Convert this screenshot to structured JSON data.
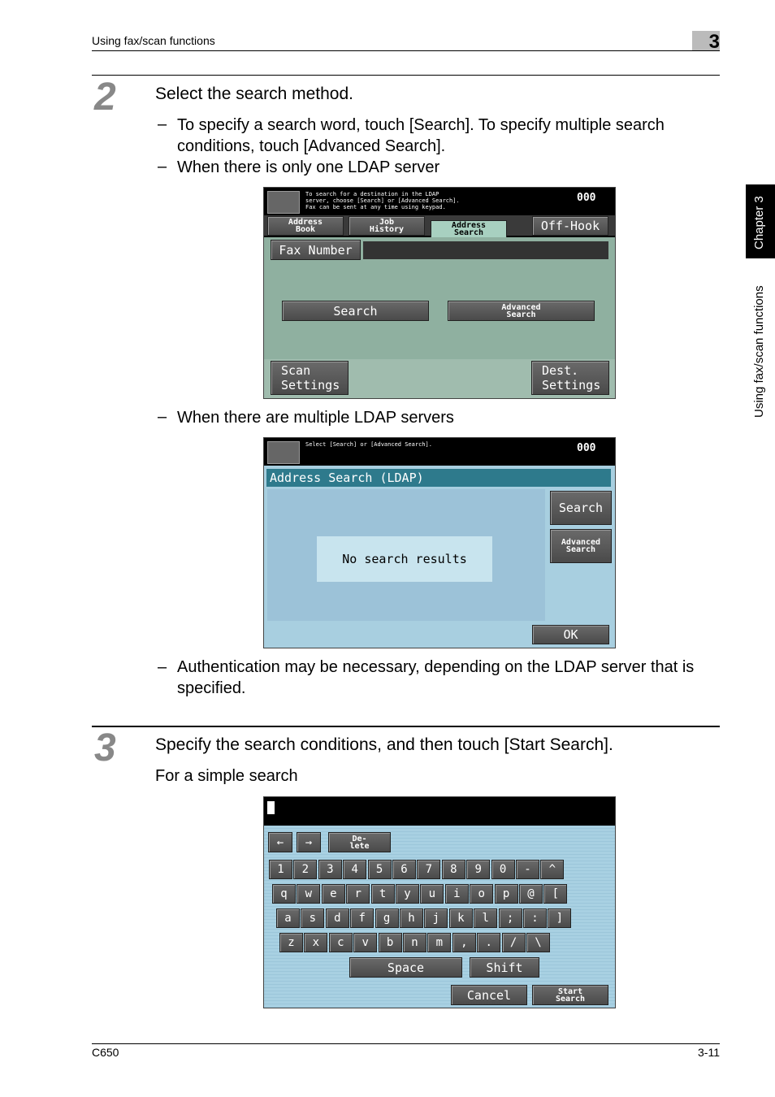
{
  "header": {
    "section": "Using fax/scan functions",
    "chapter_number": "3"
  },
  "side_tab": {
    "chapter": "Chapter 3",
    "section": "Using fax/scan functions"
  },
  "step2": {
    "number": "2",
    "title": "Select the search method.",
    "bullets": [
      "To specify a search word, touch [Search]. To specify multiple search",
      "conditions, touch [Advanced Search].",
      "When there is only one LDAP server",
      "When there are multiple LDAP servers",
      "Authentication may be necessary, depending on the LDAP server that is",
      "specified."
    ],
    "dash": "–"
  },
  "screen1": {
    "message": [
      "To search for a destination in the LDAP",
      "server, choose [Search] or [Advanced Search].",
      "Fax can be sent at any time using keypad."
    ],
    "counter": "000",
    "tabs": [
      {
        "label": "Address\nBook"
      },
      {
        "label": "Job\nHistory"
      },
      {
        "label": "Address\nSearch",
        "active": true
      }
    ],
    "off_hook": "Off-Hook",
    "fax_number": "Fax Number",
    "search": "Search",
    "advanced_search": "Advanced\nSearch",
    "scan_settings": "Scan\nSettings",
    "dest_settings": "Dest.\nSettings",
    "colors": {
      "panel": "#8fb0a0",
      "active_tab": "#a8d0c0"
    }
  },
  "screen2": {
    "message": "Select [Search] or [Advanced Search].",
    "counter": "000",
    "title": "Address Search (LDAP)",
    "search": "Search",
    "advanced_search": "Advanced\nSearch",
    "result": "No search results",
    "ok": "OK",
    "colors": {
      "title_bar": "#2e7a8c",
      "panel": "#a8cfe0"
    }
  },
  "step3": {
    "number": "3",
    "title": "Specify the search conditions, and then touch [Start Search].",
    "subtitle": "For a simple search"
  },
  "screen3": {
    "delete": "De-\nlete",
    "rows": [
      [
        "1",
        "2",
        "3",
        "4",
        "5",
        "6",
        "7",
        "8",
        "9",
        "0",
        "-",
        "^"
      ],
      [
        "q",
        "w",
        "e",
        "r",
        "t",
        "y",
        "u",
        "i",
        "o",
        "p",
        "@",
        "["
      ],
      [
        "a",
        "s",
        "d",
        "f",
        "g",
        "h",
        "j",
        "k",
        "l",
        ";",
        ":",
        "]"
      ],
      [
        "z",
        "x",
        "c",
        "v",
        "b",
        "n",
        "m",
        ",",
        ".",
        "/",
        "\\"
      ]
    ],
    "space": "Space",
    "shift": "Shift",
    "cancel": "Cancel",
    "start_search": "Start\nSearch"
  },
  "footer": {
    "model": "C650",
    "page": "3-11"
  }
}
